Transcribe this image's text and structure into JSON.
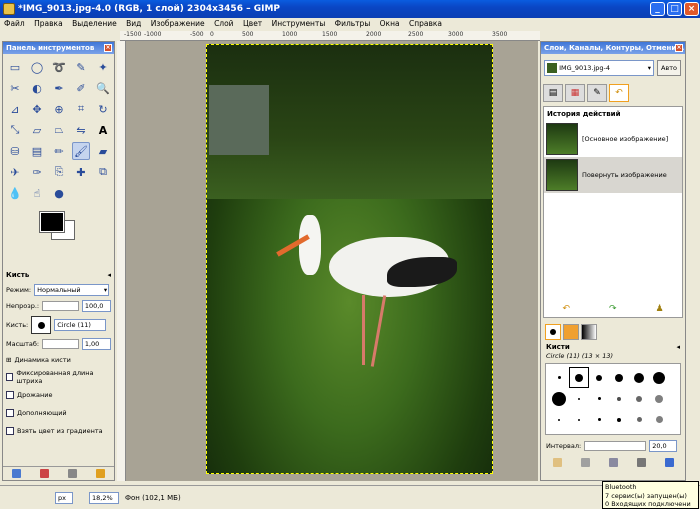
{
  "window": {
    "title": "*IMG_9013.jpg-4.0 (RGB, 1 слой) 2304x3456 – GIMP"
  },
  "menu": [
    "Файл",
    "Правка",
    "Выделение",
    "Вид",
    "Изображение",
    "Слой",
    "Цвет",
    "Инструменты",
    "Фильтры",
    "Окна",
    "Справка"
  ],
  "ruler": {
    "labels": [
      "-1500",
      "-1000",
      "-500",
      "0",
      "500",
      "1000",
      "1500",
      "2000",
      "2500",
      "3000",
      "3500"
    ]
  },
  "toolbox": {
    "title": "Панель инструментов",
    "options_title": "Кисть",
    "mode_label": "Режим:",
    "mode_value": "Нормальный",
    "opacity_label": "Непрозр.:",
    "opacity_value": "100,0",
    "brush_label": "Кисть:",
    "brush_value": "Circle (11)",
    "scale_label": "Масштаб:",
    "scale_value": "1,00",
    "dynamics_label": "Динамика кисти",
    "fixed_length_label": "Фиксированная длина штриха",
    "jitter_label": "Дрожание",
    "incremental_label": "Дополняющий",
    "gradient_label": "Взять цвет из градиента"
  },
  "dock": {
    "title": "Слои, Каналы, Контуры, Отмени...",
    "image_select": "IMG_9013.jpg-4",
    "auto_button": "Авто",
    "history_title": "История действий",
    "history_items": [
      "[Основное изображение]",
      "Повернуть изображение"
    ],
    "brushes_title": "Кисти",
    "brush_name": "Circle (11) (13 × 13)",
    "interval_label": "Интервал:",
    "interval_value": "20,0"
  },
  "status": {
    "unit": "px",
    "zoom": "18,2%",
    "info": "Фон (102,1 МБ)"
  },
  "tooltip": {
    "lines": [
      "Bluetooth",
      "7 сервис(ы) запущен(ы)",
      "0 Входящих подключени"
    ]
  }
}
